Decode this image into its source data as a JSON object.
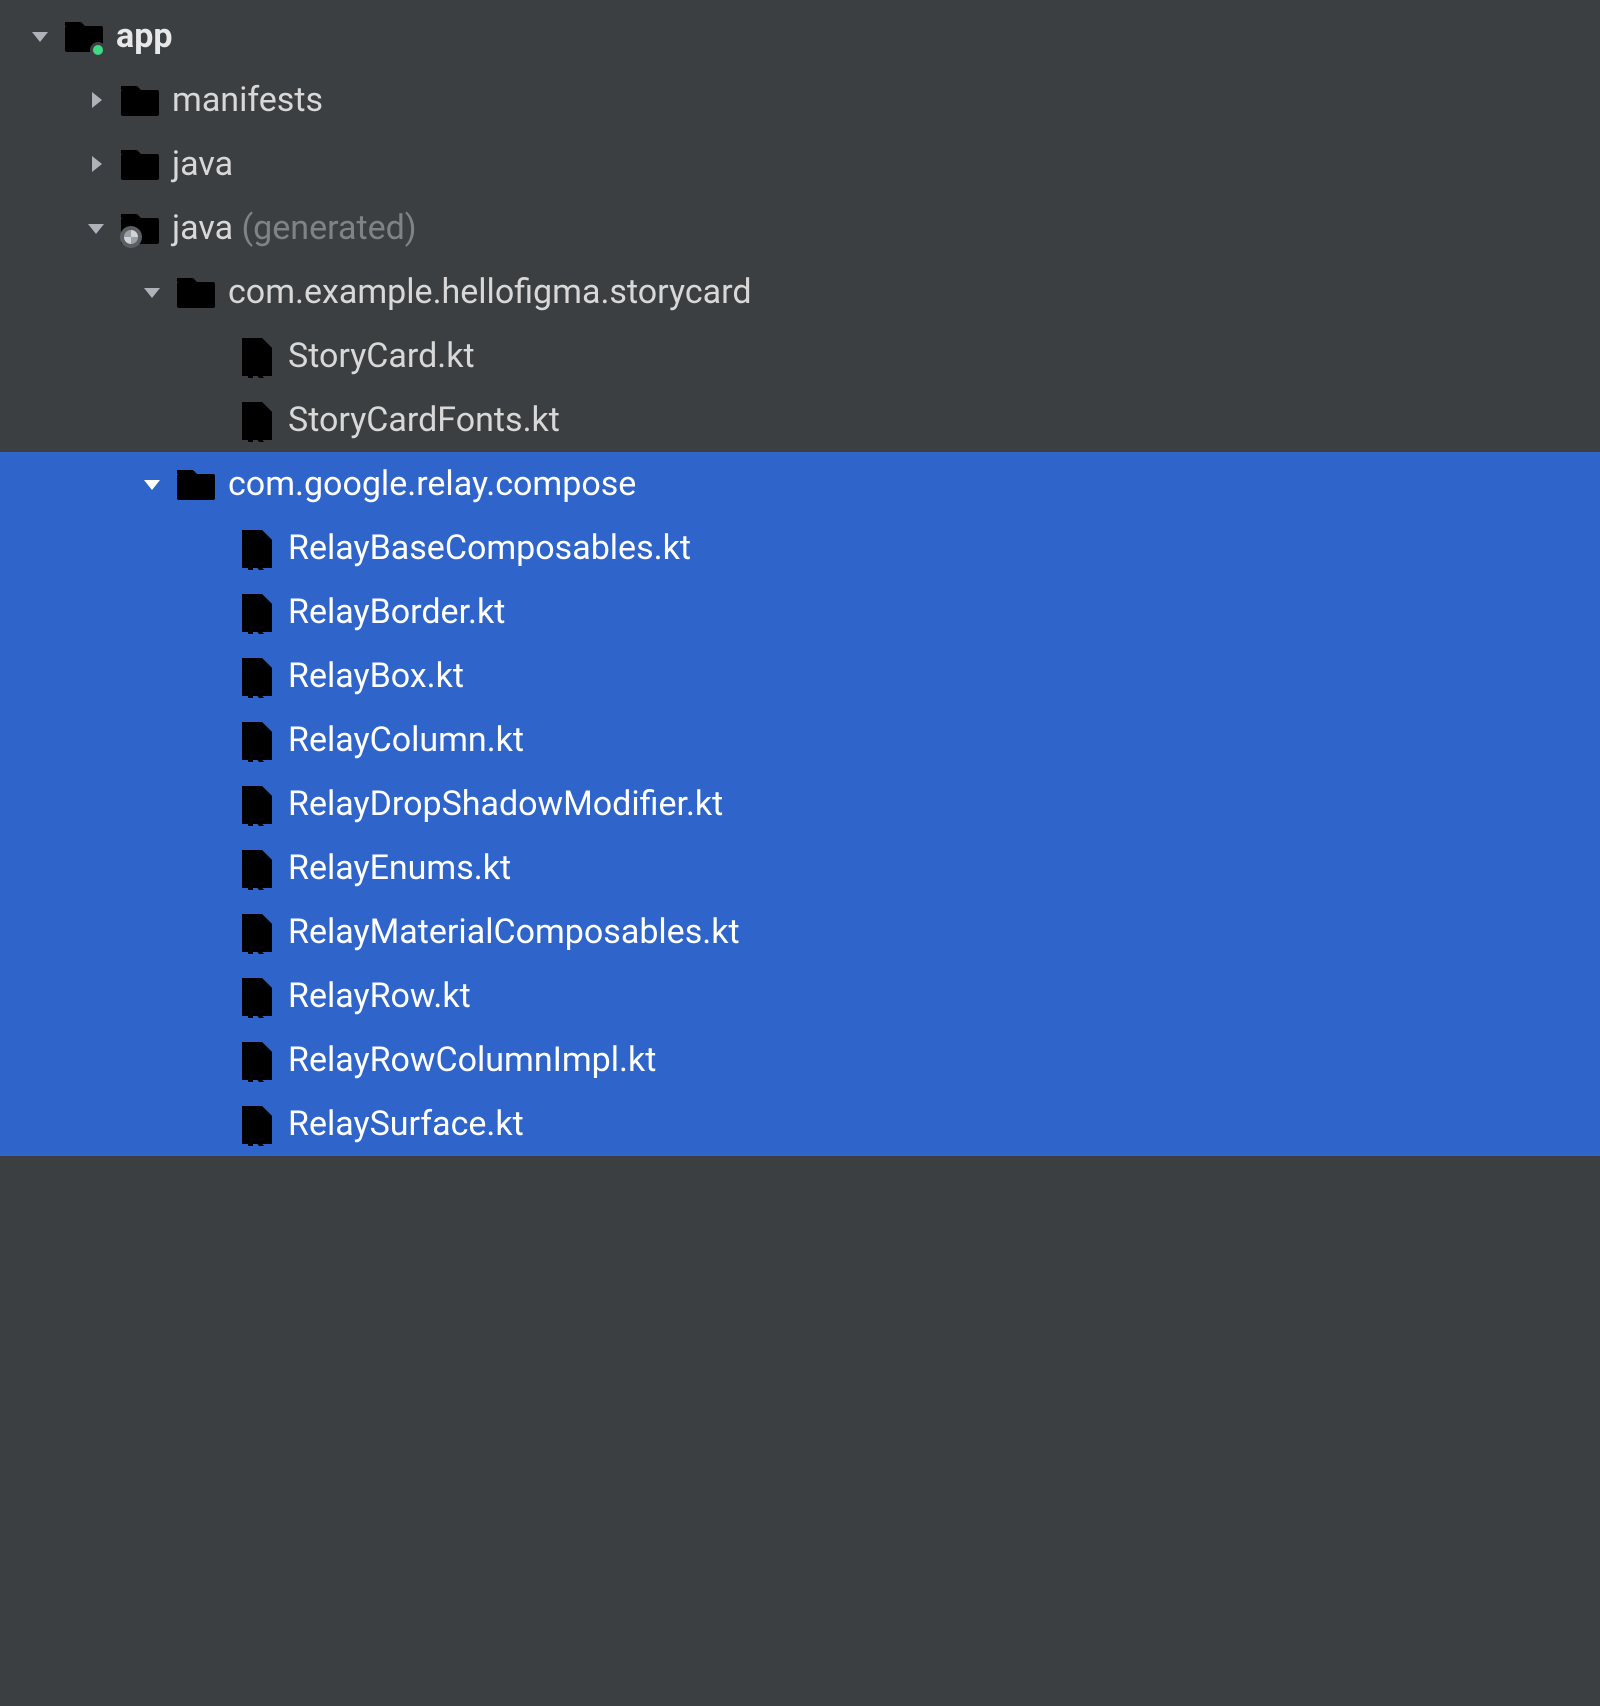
{
  "tree": {
    "app": {
      "label": "app"
    },
    "manifests": {
      "label": "manifests"
    },
    "java": {
      "label": "java"
    },
    "java_gen": {
      "label": "java",
      "suffix": "(generated)"
    },
    "pkg_story": {
      "label": "com.example.hellofigma.storycard"
    },
    "pkg_relay": {
      "label": "com.google.relay.compose"
    },
    "files_story": [
      "StoryCard.kt",
      "StoryCardFonts.kt"
    ],
    "files_relay": [
      "RelayBaseComposables.kt",
      "RelayBorder.kt",
      "RelayBox.kt",
      "RelayColumn.kt",
      "RelayDropShadowModifier.kt",
      "RelayEnums.kt",
      "RelayMaterialComposables.kt",
      "RelayRow.kt",
      "RelayRowColumnImpl.kt",
      "RelaySurface.kt"
    ]
  }
}
